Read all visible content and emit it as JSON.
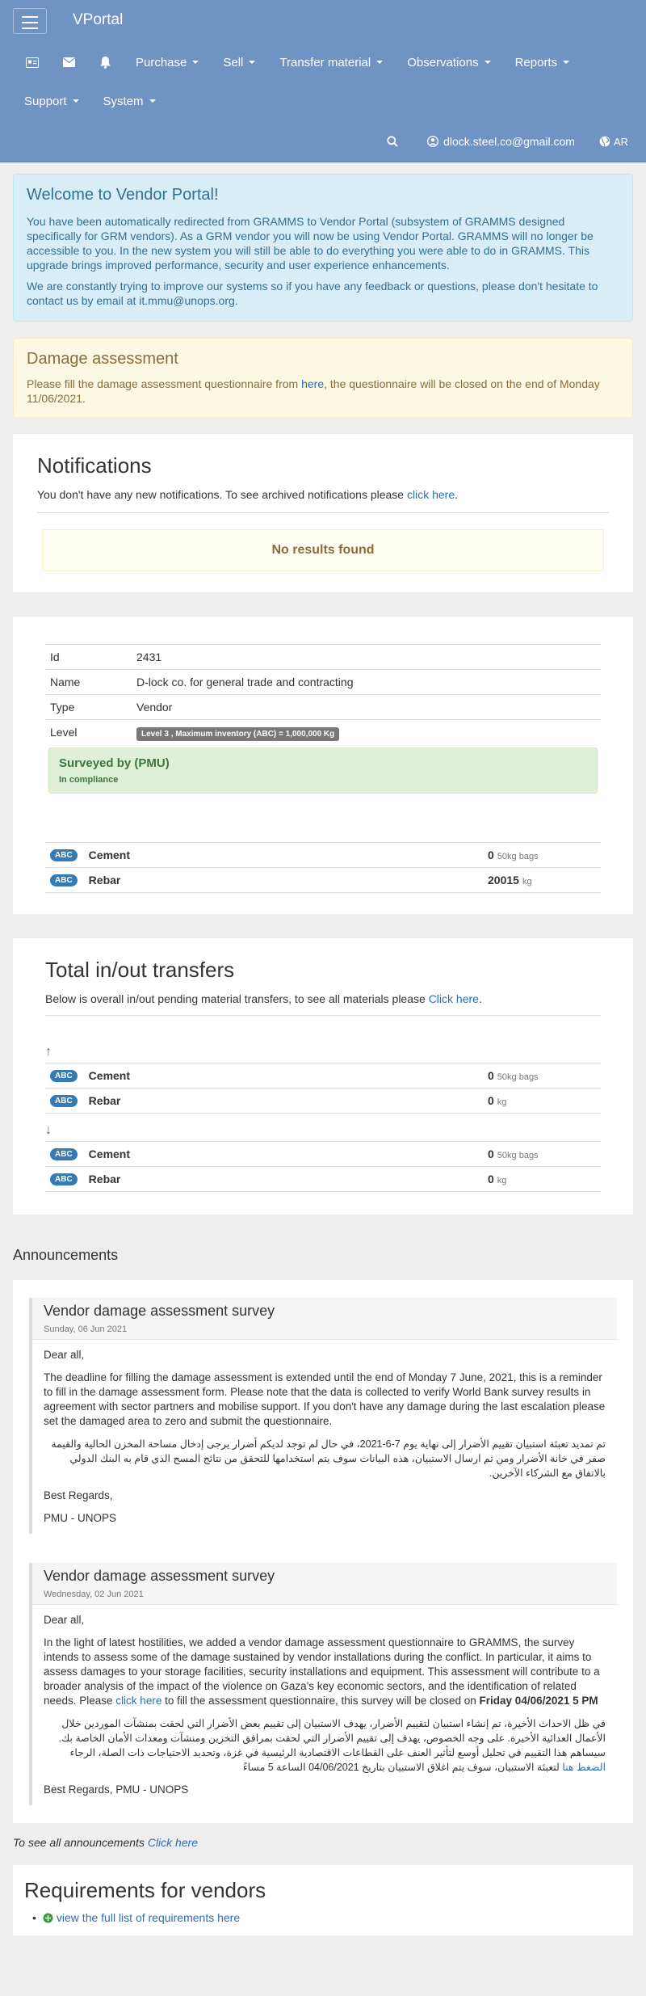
{
  "nav": {
    "brand": "VPortal",
    "menu": [
      "Purchase",
      "Sell",
      "Transfer material",
      "Observations",
      "Reports",
      "Support",
      "System"
    ],
    "user_email": "dlock.steel.co@gmail.com",
    "lang": "AR"
  },
  "welcome": {
    "title": "Welcome to Vendor Portal!",
    "p1": "You have been automatically redirected from GRAMMS to Vendor Portal (subsystem of GRAMMS designed specifically for GRM vendors). As a GRM vendor you will now be using Vendor Portal. GRAMMS will no longer be accessible to you. In the new system you will still be able to do everything you were able to do in GRAMMS. This upgrade brings improved performance, security and user experience enhancements.",
    "p2": "We are constantly trying to improve our systems so if you have any feedback or questions, please don't hesitate to contact us by email at it.mmu@unops.org."
  },
  "damage": {
    "title": "Damage assessment",
    "text_before": "Please fill the damage assessment questionnaire from ",
    "link": "here",
    "text_after": ", the questionnaire will be closed on the end of Monday 11/06/2021."
  },
  "notifications": {
    "title": "Notifications",
    "text": "You don't have any new notifications. To see archived notifications please ",
    "link": "click here",
    "empty": "No results found"
  },
  "vendor": {
    "rows": [
      {
        "label": "Id",
        "value": "2431"
      },
      {
        "label": "Name",
        "value": "D-lock co. for general trade and contracting"
      },
      {
        "label": "Type",
        "value": "Vendor"
      }
    ],
    "level_label": "Level",
    "level_value": "Level 3 , Maximum inventory (ABC) = 1,000,000 Kg",
    "surveyed_title": "Surveyed by (PMU)",
    "surveyed_status": "In compliance",
    "materials": [
      {
        "badge": "ABC",
        "name": "Cement",
        "qty": "0",
        "unit": "50kg bags"
      },
      {
        "badge": "ABC",
        "name": "Rebar",
        "qty": "20015",
        "unit": "kg"
      }
    ]
  },
  "transfers": {
    "title": "Total in/out transfers",
    "text": "Below is overall in/out pending material transfers, to see all materials please ",
    "link": "Click here",
    "in_arrow": "↑",
    "out_arrow": "↓",
    "in": [
      {
        "badge": "ABC",
        "name": "Cement",
        "qty": "0",
        "unit": "50kg bags"
      },
      {
        "badge": "ABC",
        "name": "Rebar",
        "qty": "0",
        "unit": "kg"
      }
    ],
    "out": [
      {
        "badge": "ABC",
        "name": "Cement",
        "qty": "0",
        "unit": "50kg bags"
      },
      {
        "badge": "ABC",
        "name": "Rebar",
        "qty": "0",
        "unit": "kg"
      }
    ]
  },
  "announcements": {
    "heading": "Announcements",
    "a1": {
      "title": "Vendor damage assessment survey",
      "date": "Sunday, 06 Jun 2021",
      "greeting": "Dear all,",
      "body": "The deadline for filling the damage assessment is extended until the end of Monday 7 June, 2021, this is a reminder to fill in the damage assessment form. Please note that the data is collected to verify World Bank survey results in agreement with sector partners and mobilise support. If you don't have any damage during the last escalation please set the damaged area to zero and submit the questionnaire.",
      "arabic": "تم تمديد تعبئة استبيان تقييم الأضرار إلى نهاية يوم 7-6-2021، في حال لم توجد لديكم أضرار يرجى إدخال مساحة المخزن الحالية والقيمة صفر في خانة الأضرار ومن ثم ارسال الاستبيان، هذه البيانات سوف يتم استخدامها للتحقق من نتائج المسح الذي قام به البنك الدولي بالاتفاق مع الشركاء الآخرين.",
      "regards": "Best Regards,",
      "sign": "PMU - UNOPS"
    },
    "a2": {
      "title": "Vendor damage assessment survey",
      "date": "Wednesday, 02 Jun 2021",
      "greeting": "Dear all,",
      "body_before": "In the light of latest hostilities, we added a vendor damage assessment questionnaire to GRAMMS, the survey intends to assess some of the damage sustained by vendor installations during the conflict. In particular, it aims to assess damages to your storage facilities, security installations and equipment. This assessment will contribute to a broader analysis of the impact of the violence on Gaza's key economic sectors, and the identification of related needs. Please ",
      "link": "click here",
      "body_after": " to fill the assessment questionnaire, this survey will be closed on ",
      "deadline": "Friday 04/06/2021 5 PM",
      "arabic_before": "في ظل الاحداث الأخيرة، تم إنشاء استبيان لتقييم الأضرار، يهدف الاستبيان إلى تقييم بعض الأضرار التي لحقت بمنشآت الموردين خلال الأعمال العدائية الأخيرة. على وجه الخصوص، يهدف إلى تقييم الأضرار التي لحقت بمرافق التخزين ومنشآت ومعدات الأمان الخاصة بك. سيساهم هذا التقييم في تحليل أوسع لتأثير العنف على القطاعات الاقتصادية الرئيسية في غزة، وتحديد الاحتياجات ذات الصلة، الرجاء ",
      "arabic_link": "الضغط هنا",
      "arabic_after": " لتعبئة الاستبيان، سوف يتم اغلاق الاستبيان بتاريخ 04/06/2021 الساعة 5 مساءً",
      "regards": "Best Regards, PMU - UNOPS"
    },
    "see_all_text": "To see all announcements ",
    "see_all_link": "Click here"
  },
  "requirements": {
    "title": "Requirements for vendors",
    "link": "view the full list of requirements here"
  }
}
